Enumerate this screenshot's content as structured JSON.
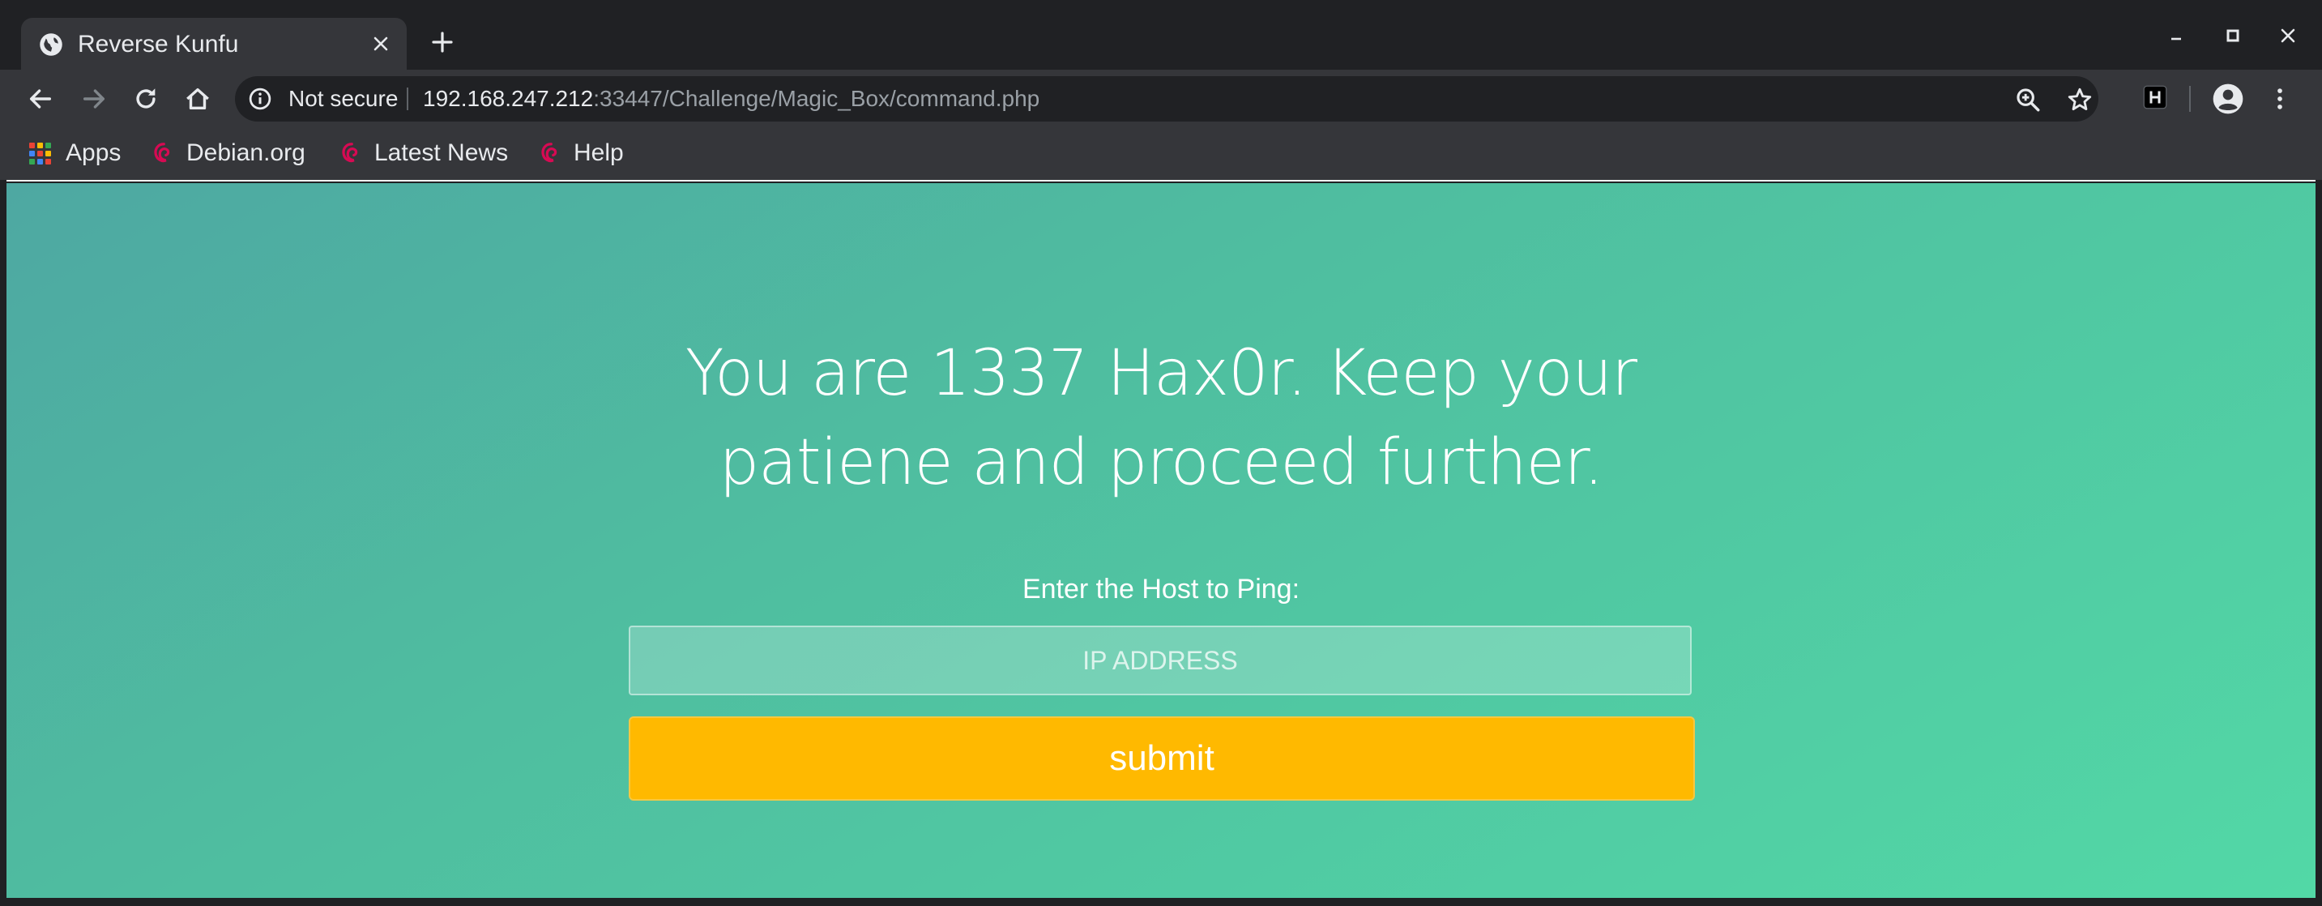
{
  "tabs": [
    {
      "title": "Reverse Kunfu",
      "icon": "globe-icon"
    }
  ],
  "window_controls": [
    "minimize-icon",
    "maximize-icon",
    "close-icon"
  ],
  "toolbar": {
    "security_label": "Not secure",
    "url_host": "192.168.247.212",
    "url_rest": ":33447/Challenge/Magic_Box/command.php"
  },
  "bookmarks": [
    {
      "label": "Apps",
      "icon": "apps-grid-icon"
    },
    {
      "label": "Debian.org",
      "icon": "debian-swirl-icon"
    },
    {
      "label": "Latest News",
      "icon": "debian-swirl-icon"
    },
    {
      "label": "Help",
      "icon": "debian-swirl-icon"
    }
  ],
  "page": {
    "title_line1": "You are 1337 Hax0r. Keep your",
    "title_line2": "patiene and proceed further.",
    "host_label": "Enter the Host to Ping:",
    "ip_placeholder": "IP ADDRESS",
    "ip_value": "",
    "submit_label": "submit"
  },
  "colors": {
    "chrome_dark": "#202124",
    "chrome_toolbar": "#35363a",
    "page_gradient_start": "#4ea8a2",
    "page_gradient_end": "#52d8a6",
    "submit_button": "#ffb900",
    "debian_red": "#d70a53"
  }
}
